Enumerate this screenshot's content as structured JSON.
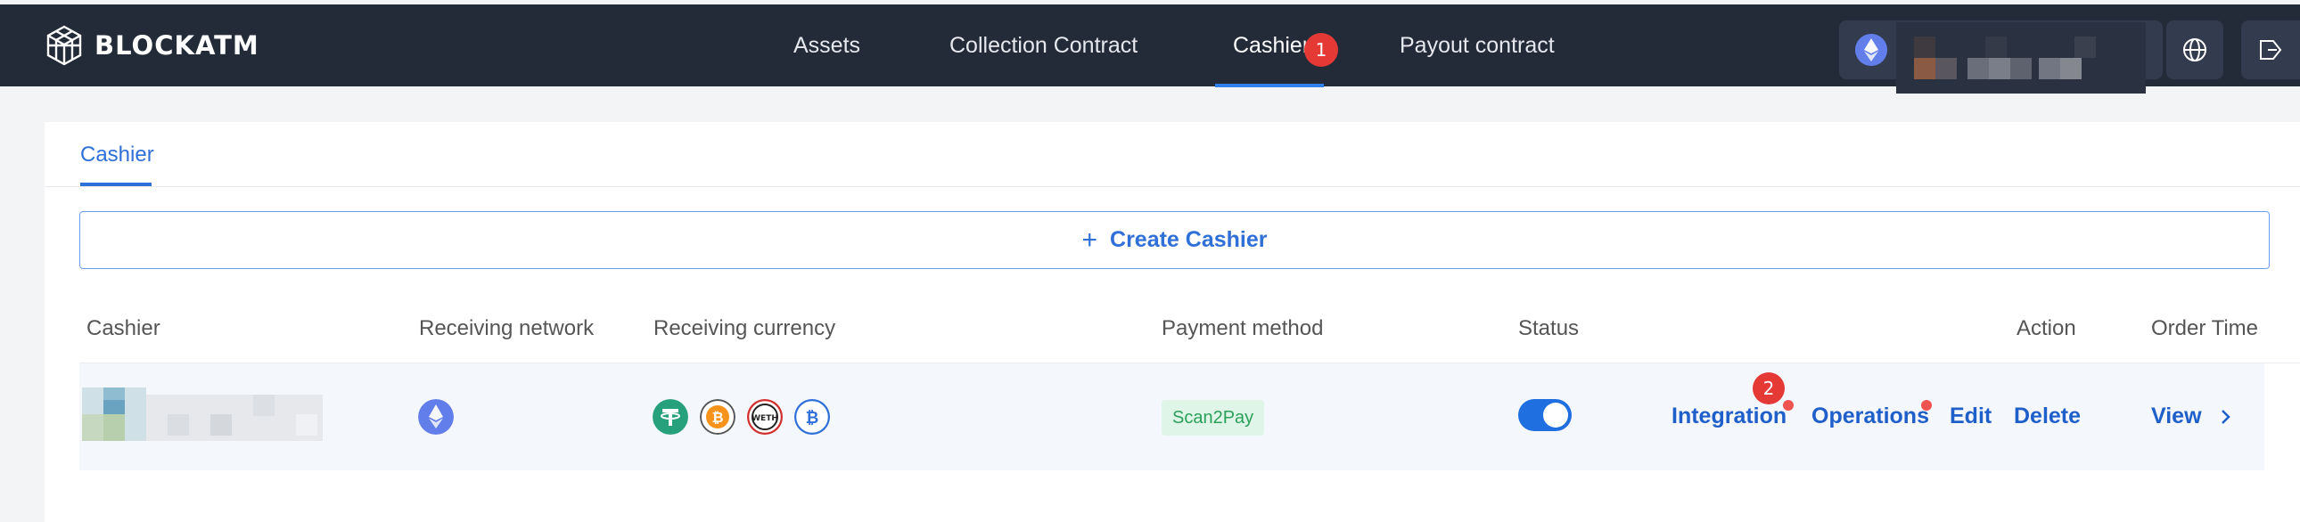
{
  "app": {
    "brand": "BLOCKATM"
  },
  "nav": {
    "items": [
      {
        "label": "Assets"
      },
      {
        "label": "Collection Contract"
      },
      {
        "label": "Cashier",
        "active": true
      },
      {
        "label": "Payout contract"
      }
    ]
  },
  "markers": {
    "first": "1",
    "second": "2"
  },
  "page": {
    "tab": "Cashier",
    "create_label": "Create Cashier"
  },
  "table": {
    "headers": [
      "Cashier",
      "Receiving network",
      "Receiving currency",
      "Payment method",
      "Status",
      "Action",
      "Order Time"
    ],
    "rows": [
      {
        "network_icon": "ethereum-icon",
        "currency_icons": [
          "usdt-icon",
          "btc-icon",
          "weth-icon",
          "wbtc-icon"
        ],
        "currency_labels": {
          "weth": "WETH"
        },
        "payment_method": "Scan2Pay",
        "status_enabled": true,
        "actions": [
          "Integration",
          "Operations",
          "Edit",
          "Delete"
        ],
        "order_time": "View"
      }
    ]
  },
  "colors": {
    "accent": "#2f6fd8",
    "topbar": "#232a38",
    "marker": "#e53935",
    "badge_text": "#2aa15a"
  }
}
